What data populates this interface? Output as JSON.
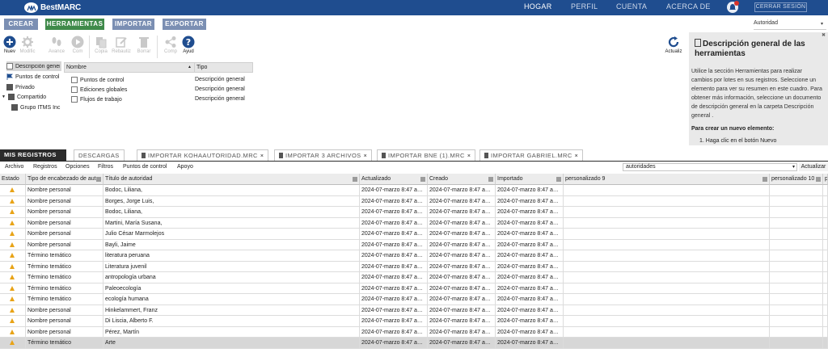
{
  "brand": {
    "name": "BestMARC"
  },
  "nav": {
    "hogar": "HOGAR",
    "perfil": "PERFIL",
    "cuenta": "CUENTA",
    "acerca": "ACERCA DE",
    "logout": "CERRAR SESIÓN",
    "notification_count": "1"
  },
  "top_buttons": {
    "crear": "CREAR",
    "herramientas": "HERRAMIENTAS",
    "importar": "IMPORTAR",
    "exportar": "EXPORTAR"
  },
  "authority_select": {
    "value": "Autoridad"
  },
  "toolbar": {
    "nuevo": "Nuev",
    "modific": "Modific",
    "avance": "Avance",
    "com": "Com",
    "copia": "Copia",
    "rebautiz": "Rebautiz",
    "borrar": "Borrar",
    "comp": "Comp",
    "ayud": "Ayud",
    "actualiz": "Actualiz"
  },
  "tree": {
    "items": [
      {
        "label": "Descripción general"
      },
      {
        "label": "Puntos de control"
      },
      {
        "label": "Privado"
      },
      {
        "label": "Compartido"
      },
      {
        "label": "Grupo ITMS Inc"
      }
    ]
  },
  "list": {
    "col_nombre": "Nombre",
    "col_tipo": "Tipo",
    "rows": [
      {
        "nombre": "Puntos de control",
        "tipo": "Descripción general"
      },
      {
        "nombre": "Ediciones globales",
        "tipo": "Descripción general"
      },
      {
        "nombre": "Flujos de trabajo",
        "tipo": "Descripción general"
      }
    ]
  },
  "help_panel": {
    "title": "Descripción general de las herramientas",
    "body": "Utilice la sección Herramientas para realizar cambios por lotes en sus registros. Seleccione un elemento para ver su resumen en este cuadro. Para obtener más información, seleccione un documento de descripción general en la carpeta Descripción general .",
    "subtitle": "Para crear un nuevo elemento:",
    "step1": "1. Haga clic en el botón Nuevo"
  },
  "tabs": [
    {
      "label": "MIS REGISTROS"
    },
    {
      "label": "DESCARGAS"
    },
    {
      "label": "IMPORTAR KOHAAUTORIDAD.MRC"
    },
    {
      "label": "IMPORTAR 3 ARCHIVOS"
    },
    {
      "label": "IMPORTAR BNE (1).MRC"
    },
    {
      "label": "IMPORTAR GABRIEL.MRC"
    }
  ],
  "tab_close": "×",
  "menubar": {
    "archivo": "Archivo",
    "registros": "Registros",
    "opciones": "Opciones",
    "filtros": "Filtros",
    "puntos": "Puntos de control",
    "apoyo": "Apoyo"
  },
  "filter_select": {
    "value": "autoridades"
  },
  "update_button": "Actualizar",
  "grid": {
    "headers": {
      "estado": "Estado",
      "tipo": "Tipo de encabezado de aut…",
      "titulo": "Título de autoridad",
      "actualizado": "Actualizado",
      "creado": "Creado",
      "importado": "Importado",
      "p9": "personalizado 9",
      "p10": "personalizado 10",
      "p11": "p"
    },
    "rows": [
      {
        "tipo": "Nombre personal",
        "titulo": "Bodoc, Liliana,",
        "actualizado": "2024-07-marzo 8:47 a…",
        "creado": "2024-07-marzo 8:47 a…",
        "importado": "2024-07-marzo 8:47 a…"
      },
      {
        "tipo": "Nombre personal",
        "titulo": "Borges, Jorge Luis,",
        "actualizado": "2024-07-marzo 8:47 a…",
        "creado": "2024-07-marzo 8:47 a…",
        "importado": "2024-07-marzo 8:47 a…"
      },
      {
        "tipo": "Nombre personal",
        "titulo": "Bodoc, Liliana,",
        "actualizado": "2024-07-marzo 8:47 a…",
        "creado": "2024-07-marzo 8:47 a…",
        "importado": "2024-07-marzo 8:47 a…"
      },
      {
        "tipo": "Nombre personal",
        "titulo": "Martini, María Susana,",
        "actualizado": "2024-07-marzo 8:47 a…",
        "creado": "2024-07-marzo 8:47 a…",
        "importado": "2024-07-marzo 8:47 a…"
      },
      {
        "tipo": "Nombre personal",
        "titulo": "Julio César Marmolejos",
        "actualizado": "2024-07-marzo 8:47 a…",
        "creado": "2024-07-marzo 8:47 a…",
        "importado": "2024-07-marzo 8:47 a…"
      },
      {
        "tipo": "Nombre personal",
        "titulo": "Bayli, Jaime",
        "actualizado": "2024-07-marzo 8:47 a…",
        "creado": "2024-07-marzo 8:47 a…",
        "importado": "2024-07-marzo 8:47 a…"
      },
      {
        "tipo": "Término temático",
        "titulo": "literatura peruana",
        "actualizado": "2024-07-marzo 8:47 a…",
        "creado": "2024-07-marzo 8:47 a…",
        "importado": "2024-07-marzo 8:47 a…"
      },
      {
        "tipo": "Término temático",
        "titulo": "Literatura juvenil",
        "actualizado": "2024-07-marzo 8:47 a…",
        "creado": "2024-07-marzo 8:47 a…",
        "importado": "2024-07-marzo 8:47 a…"
      },
      {
        "tipo": "Término temático",
        "titulo": "antropología urbana",
        "actualizado": "2024-07-marzo 8:47 a…",
        "creado": "2024-07-marzo 8:47 a…",
        "importado": "2024-07-marzo 8:47 a…"
      },
      {
        "tipo": "Término temático",
        "titulo": "Paleoecología",
        "actualizado": "2024-07-marzo 8:47 a…",
        "creado": "2024-07-marzo 8:47 a…",
        "importado": "2024-07-marzo 8:47 a…"
      },
      {
        "tipo": "Término temático",
        "titulo": "ecología humana",
        "actualizado": "2024-07-marzo 8:47 a…",
        "creado": "2024-07-marzo 8:47 a…",
        "importado": "2024-07-marzo 8:47 a…"
      },
      {
        "tipo": "Nombre personal",
        "titulo": "Hinkelammert, Franz",
        "actualizado": "2024-07-marzo 8:47 a…",
        "creado": "2024-07-marzo 8:47 a…",
        "importado": "2024-07-marzo 8:47 a…"
      },
      {
        "tipo": "Nombre personal",
        "titulo": "Di Liscia, Alberto F.",
        "actualizado": "2024-07-marzo 8:47 a…",
        "creado": "2024-07-marzo 8:47 a…",
        "importado": "2024-07-marzo 8:47 a…"
      },
      {
        "tipo": "Nombre personal",
        "titulo": "Pérez, Martín",
        "actualizado": "2024-07-marzo 8:47 a…",
        "creado": "2024-07-marzo 8:47 a…",
        "importado": "2024-07-marzo 8:47 a…"
      },
      {
        "tipo": "Término temático",
        "titulo": "Arte",
        "actualizado": "2024-07-marzo 8:47 a…",
        "creado": "2024-07-marzo 8:47 a…",
        "importado": "2024-07-marzo 8:47 a…"
      }
    ]
  },
  "colors": {
    "nav_bg": "#1f4d8f",
    "herramientas_green": "#3f8a4a",
    "button_gray": "#7b8fb3",
    "warning": "#e8a317"
  }
}
